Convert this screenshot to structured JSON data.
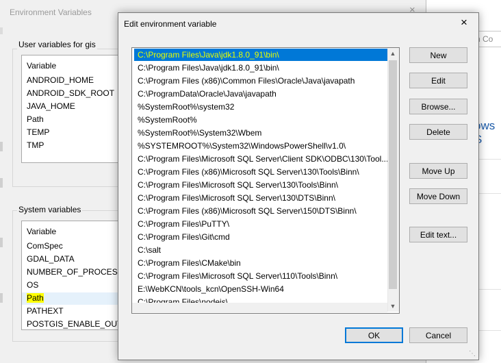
{
  "background_window": {
    "title": "Environment Variables",
    "close_glyph": "×",
    "user_group_label": "User variables for gis",
    "user_column": "Variable",
    "user_vars": [
      "ANDROID_HOME",
      "ANDROID_SDK_ROOT",
      "JAVA_HOME",
      "Path",
      "TEMP",
      "TMP"
    ],
    "system_group_label": "System variables",
    "system_column": "Variable",
    "system_vars": [
      "ComSpec",
      "GDAL_DATA",
      "NUMBER_OF_PROCESSOR",
      "OS",
      "Path",
      "PATHEXT",
      "POSTGIS_ENABLE_OUTDE"
    ],
    "highlighted_system_var": "Path"
  },
  "right_background": {
    "search_text": "rch Co",
    "partial_heading": "ows S"
  },
  "dialog": {
    "title": "Edit environment variable",
    "close_glyph": "×",
    "entries": [
      "C:\\Program Files\\Java\\jdk1.8.0_91\\bin\\",
      "C:\\Program Files\\Java\\jdk1.8.0_91\\bin\\",
      "C:\\Program Files (x86)\\Common Files\\Oracle\\Java\\javapath",
      "C:\\ProgramData\\Oracle\\Java\\javapath",
      "%SystemRoot%\\system32",
      "%SystemRoot%",
      "%SystemRoot%\\System32\\Wbem",
      "%SYSTEMROOT%\\System32\\WindowsPowerShell\\v1.0\\",
      "C:\\Program Files\\Microsoft SQL Server\\Client SDK\\ODBC\\130\\Tool...",
      "C:\\Program Files (x86)\\Microsoft SQL Server\\130\\Tools\\Binn\\",
      "C:\\Program Files\\Microsoft SQL Server\\130\\Tools\\Binn\\",
      "C:\\Program Files\\Microsoft SQL Server\\130\\DTS\\Binn\\",
      "C:\\Program Files (x86)\\Microsoft SQL Server\\150\\DTS\\Binn\\",
      "C:\\Program Files\\PuTTY\\",
      "C:\\Program Files\\Git\\cmd",
      "C:\\salt",
      "C:\\Program Files\\CMake\\bin",
      "C:\\Program Files\\Microsoft SQL Server\\110\\Tools\\Binn\\",
      "E:\\WebKCN\\tools_kcn\\OpenSSH-Win64",
      "C:\\Program Files\\nodejs\\"
    ],
    "selected_index": 0,
    "buttons": {
      "new": "New",
      "edit": "Edit",
      "browse": "Browse...",
      "delete": "Delete",
      "move_up": "Move Up",
      "move_down": "Move Down",
      "edit_text": "Edit text...",
      "ok": "OK",
      "cancel": "Cancel"
    }
  },
  "colors": {
    "selection_bg": "#0078d7",
    "selection_text": "#e9ff00",
    "highlight_yellow": "#ffff00"
  }
}
